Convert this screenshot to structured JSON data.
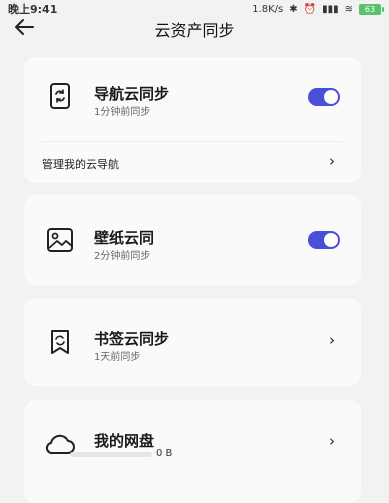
{
  "status_bar": {
    "time": "晚上9:41",
    "net_speed": "1.8K/s",
    "battery": "63"
  },
  "header": {
    "title": "云资产同步"
  },
  "sections": [
    {
      "title": "导航云同步",
      "subtitle": "1分钟前同步",
      "toggle_on": true,
      "manage_label": "管理我的云导航"
    },
    {
      "title": "壁纸云同",
      "subtitle": "2分钟前同步",
      "toggle_on": true
    },
    {
      "title": "书签云同步",
      "subtitle": "1天前同步"
    },
    {
      "title": "我的网盘",
      "storage_used": "0 B",
      "used_fraction": 0
    }
  ],
  "colors": {
    "accent": "#4b4fd6",
    "card_bg": "#fafafa",
    "page_bg": "#f2f2f2"
  },
  "icons": {
    "back": "arrow-left-icon",
    "navigation": "phone-sync-icon",
    "wallpaper": "image-icon",
    "bookmark": "bookmark-sync-icon",
    "cloud_drive": "cloud-icon",
    "chevron": "chevron-right-icon"
  }
}
